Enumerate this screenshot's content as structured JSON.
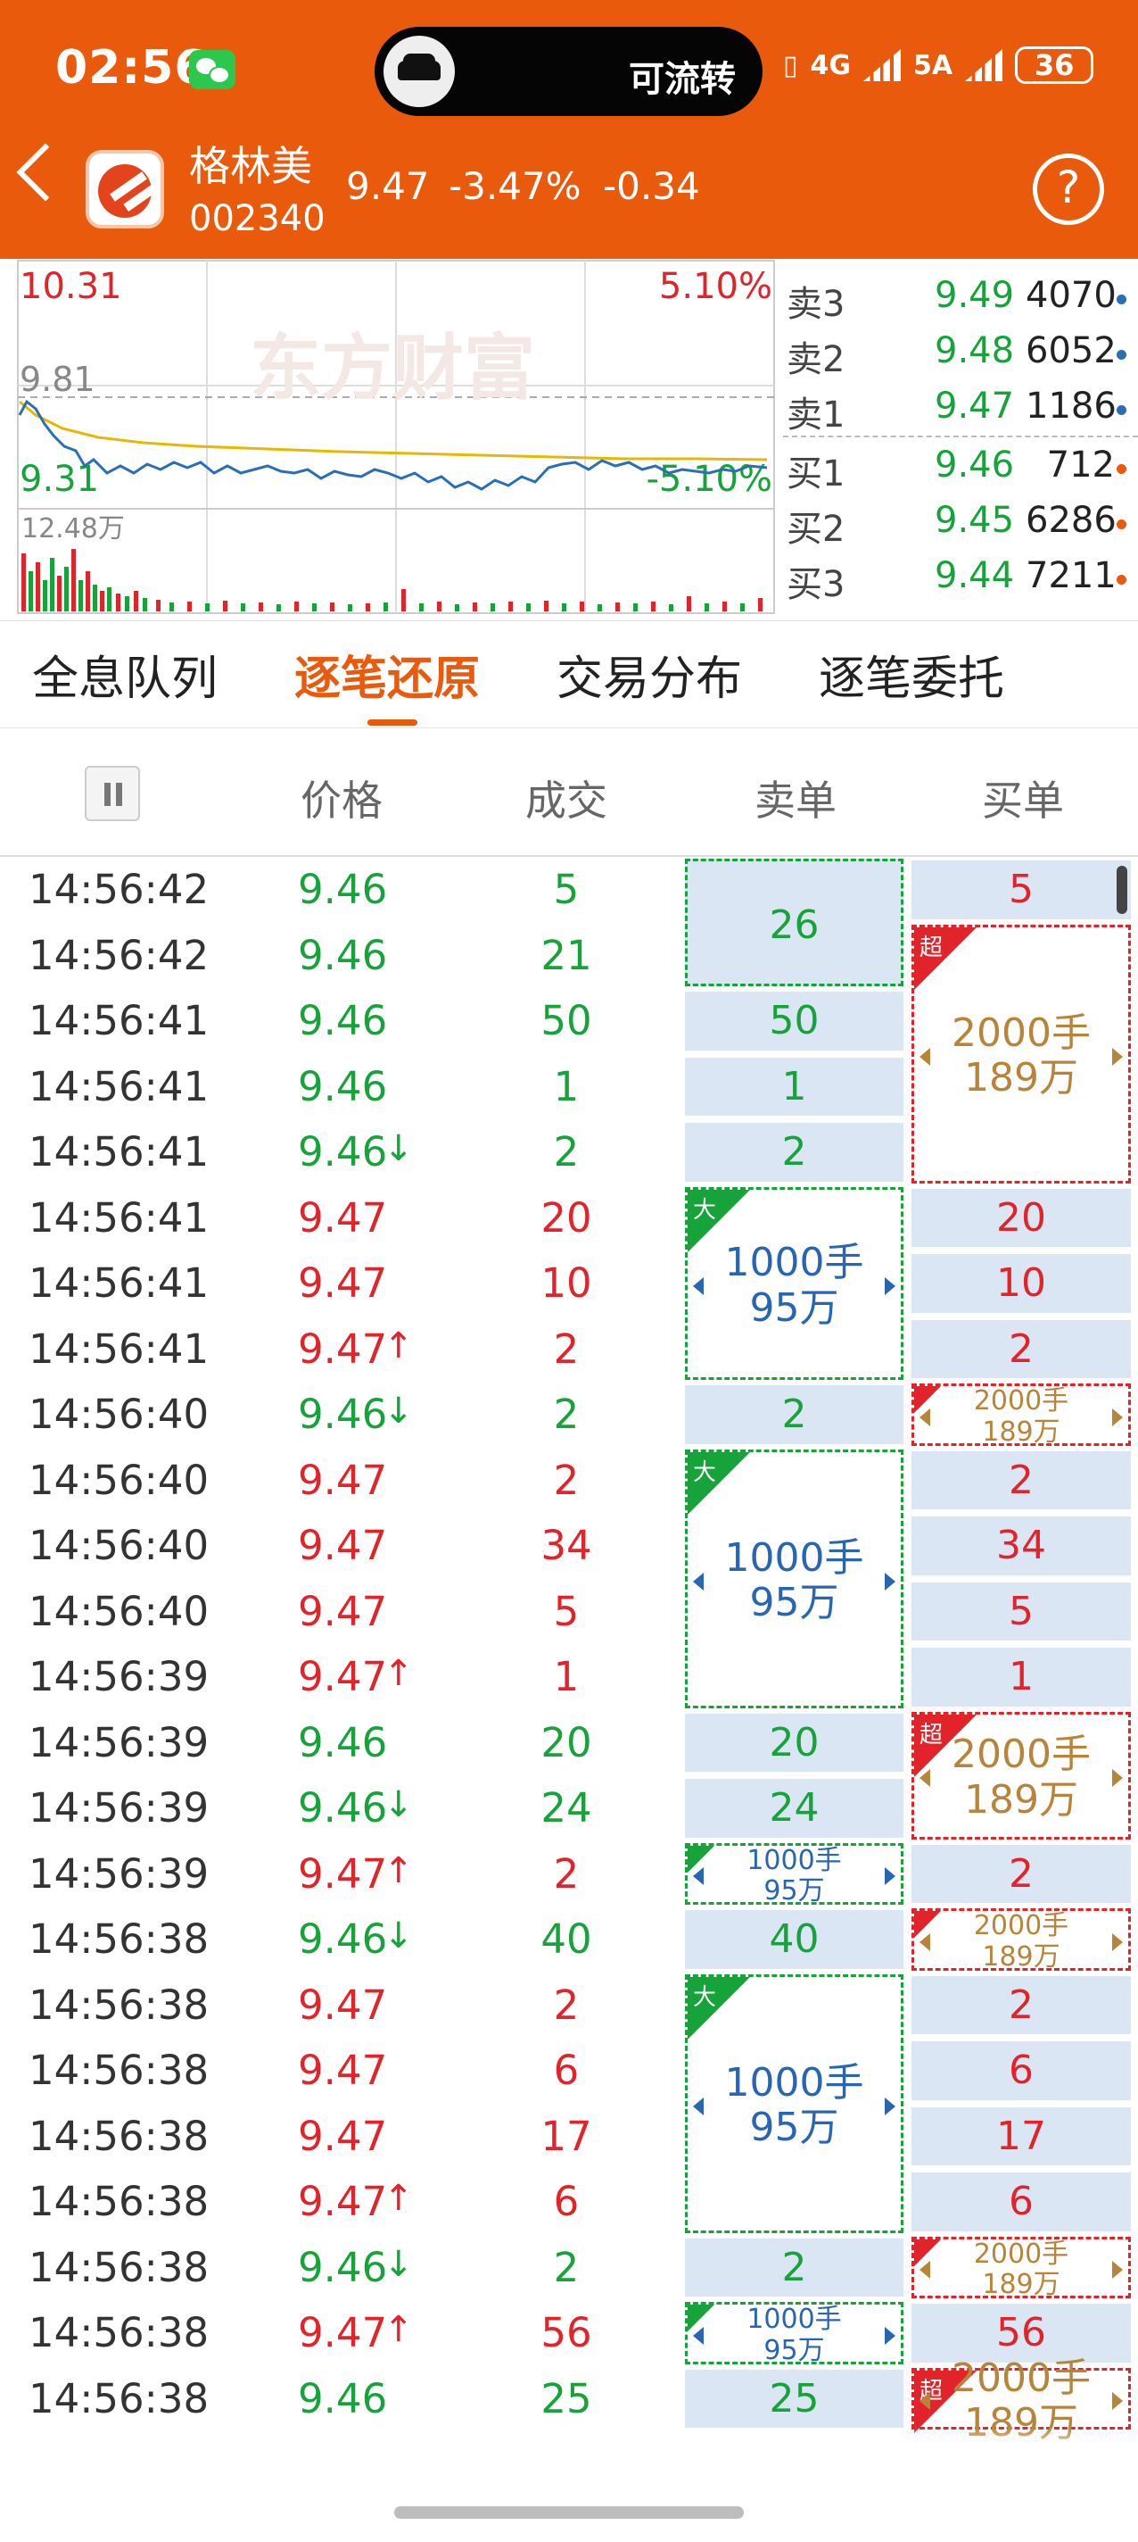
{
  "status_bar": {
    "time": "02:56",
    "pill_text": "可流转",
    "network1": "4G",
    "network2": "5A",
    "battery": "36"
  },
  "stock": {
    "name": "格林美",
    "code": "002340",
    "price": "9.47",
    "change_pct": "-3.47%",
    "change": "-0.34"
  },
  "chart": {
    "price_high": "10.31",
    "pct_high": "5.10%",
    "price_ref": "9.81",
    "price_low": "9.31",
    "pct_low": "-5.10%",
    "volume_max": "12.48万",
    "watermark": "东方财富",
    "colors": {
      "line": "#2a6fb5",
      "avg": "#e6b800",
      "up": "#e2232a",
      "down": "#16a33a"
    }
  },
  "order_book": {
    "sell": [
      {
        "label": "卖3",
        "price": "9.49",
        "vol": "4070"
      },
      {
        "label": "卖2",
        "price": "9.48",
        "vol": "6052"
      },
      {
        "label": "卖1",
        "price": "9.47",
        "vol": "1186"
      }
    ],
    "buy": [
      {
        "label": "买1",
        "price": "9.46",
        "vol": "712"
      },
      {
        "label": "买2",
        "price": "9.45",
        "vol": "6286"
      },
      {
        "label": "买3",
        "price": "9.44",
        "vol": "7211"
      }
    ]
  },
  "tabs": [
    "全息队列",
    "逐笔还原",
    "交易分布",
    "逐笔委托"
  ],
  "table_header": {
    "price": "价格",
    "volume": "成交",
    "sell": "卖单",
    "buy": "买单"
  },
  "rows": [
    {
      "time": "14:56:42",
      "price": "9.46",
      "arrow": "",
      "vol": "5",
      "dir": "down"
    },
    {
      "time": "14:56:42",
      "price": "9.46",
      "arrow": "",
      "vol": "21",
      "dir": "down"
    },
    {
      "time": "14:56:41",
      "price": "9.46",
      "arrow": "",
      "vol": "50",
      "dir": "down"
    },
    {
      "time": "14:56:41",
      "price": "9.46",
      "arrow": "",
      "vol": "1",
      "dir": "down"
    },
    {
      "time": "14:56:41",
      "price": "9.46",
      "arrow": "↓",
      "vol": "2",
      "dir": "down"
    },
    {
      "time": "14:56:41",
      "price": "9.47",
      "arrow": "",
      "vol": "20",
      "dir": "up"
    },
    {
      "time": "14:56:41",
      "price": "9.47",
      "arrow": "",
      "vol": "10",
      "dir": "up"
    },
    {
      "time": "14:56:41",
      "price": "9.47",
      "arrow": "↑",
      "vol": "2",
      "dir": "up"
    },
    {
      "time": "14:56:40",
      "price": "9.46",
      "arrow": "↓",
      "vol": "2",
      "dir": "down"
    },
    {
      "time": "14:56:40",
      "price": "9.47",
      "arrow": "",
      "vol": "2",
      "dir": "up"
    },
    {
      "time": "14:56:40",
      "price": "9.47",
      "arrow": "",
      "vol": "34",
      "dir": "up"
    },
    {
      "time": "14:56:40",
      "price": "9.47",
      "arrow": "",
      "vol": "5",
      "dir": "up"
    },
    {
      "time": "14:56:39",
      "price": "9.47",
      "arrow": "↑",
      "vol": "1",
      "dir": "up"
    },
    {
      "time": "14:56:39",
      "price": "9.46",
      "arrow": "",
      "vol": "20",
      "dir": "down"
    },
    {
      "time": "14:56:39",
      "price": "9.46",
      "arrow": "↓",
      "vol": "24",
      "dir": "down"
    },
    {
      "time": "14:56:39",
      "price": "9.47",
      "arrow": "↑",
      "vol": "2",
      "dir": "up"
    },
    {
      "time": "14:56:38",
      "price": "9.46",
      "arrow": "↓",
      "vol": "40",
      "dir": "down"
    },
    {
      "time": "14:56:38",
      "price": "9.47",
      "arrow": "",
      "vol": "2",
      "dir": "up"
    },
    {
      "time": "14:56:38",
      "price": "9.47",
      "arrow": "",
      "vol": "6",
      "dir": "up"
    },
    {
      "time": "14:56:38",
      "price": "9.47",
      "arrow": "",
      "vol": "17",
      "dir": "up"
    },
    {
      "time": "14:56:38",
      "price": "9.47",
      "arrow": "↑",
      "vol": "6",
      "dir": "up"
    },
    {
      "time": "14:56:38",
      "price": "9.46",
      "arrow": "↓",
      "vol": "2",
      "dir": "down"
    },
    {
      "time": "14:56:38",
      "price": "9.47",
      "arrow": "↑",
      "vol": "56",
      "dir": "up"
    },
    {
      "time": "14:56:38",
      "price": "9.46",
      "arrow": "",
      "vol": "25",
      "dir": "down"
    }
  ],
  "big_orders": {
    "sell_big": {
      "tag": "大",
      "lots": "1000手",
      "amount": "95万"
    },
    "buy_super": {
      "tag": "超",
      "lots": "2000手",
      "amount": "189万"
    },
    "sell_first": "26"
  }
}
